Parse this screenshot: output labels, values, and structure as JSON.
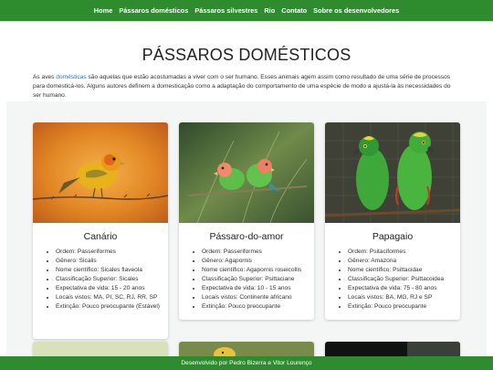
{
  "nav": {
    "items": [
      "Home",
      "Pássaros domésticos",
      "Pássaros silvestres",
      "Rio",
      "Contato",
      "Sobre os desenvolvedores"
    ]
  },
  "page": {
    "title": "PÁSSAROS DOMÉSTICOS",
    "intro_before": "As aves ",
    "intro_link": "domésticas",
    "intro_after": " são aquelas que estão acostumadas a viver com o ser humano. Esses animais agem assim como resultado de uma série de processos para domesticá-los. Alguns autores definem a domesticação como a adaptação do comportamento de uma espécie de modo a ajustá-la às necessidades do ser humano."
  },
  "cards": [
    {
      "title": "Canário",
      "facts": [
        "Ordem: Passeriformes",
        "Gênero: Sicalis",
        "Nome científico: Sicales flaveola",
        "Classificação Superior: Sicales",
        "Expectativa de vida: 15 - 20 anos",
        "Locais vistos: MA, PI, SC, RJ, RR, SP",
        "Extinção: Pouco preocupante (Estável)"
      ]
    },
    {
      "title": "Pássaro-do-amor",
      "facts": [
        "Ordem: Passeriformes",
        "Gênero: Agapornis",
        "Nome científico: Agapornis roseicollis",
        "Classificação Superior: Psittaciane",
        "Expectativa de vida: 10 - 15 anos",
        "Locais vistos: Continente africano",
        "Extinção: Pouco preocupante"
      ]
    },
    {
      "title": "Papagaio",
      "facts": [
        "Ordem: Psitaciformes",
        "Gênero: Amazona",
        "Nome científico: Psittacidae",
        "Classificação Superior: Psittacoidea",
        "Expectativa de vida: 75 - 80 anos",
        "Locais vistos: BA, MG, RJ e SP",
        "Extinção: Pouco preocupante"
      ]
    }
  ],
  "footer": {
    "text": "Desenvolvido por Pedro Bizerra e Vitor Lourenço"
  },
  "colors": {
    "nav_green": "#2e8b2e",
    "link_blue": "#1a73e8",
    "section_bg": "#f4f5f5"
  }
}
